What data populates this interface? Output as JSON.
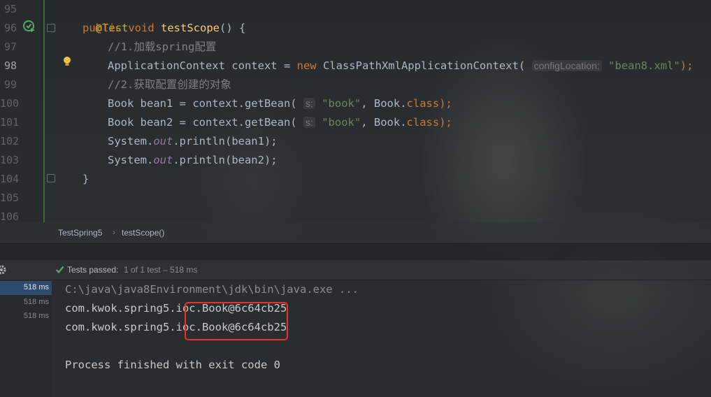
{
  "editor": {
    "line_numbers": [
      "95",
      "96",
      "97",
      "98",
      "99",
      "100",
      "101",
      "102",
      "103",
      "104",
      "105",
      "106"
    ],
    "current_line": "98",
    "lines": {
      "l95": {
        "annotation": "@Test"
      },
      "l96": {
        "kw_public": "public",
        "kw_void": "void",
        "method": "testScope",
        "rest": "() {"
      },
      "l97": {
        "comment": "//1.加载spring配置"
      },
      "l98": {
        "type": "ApplicationContext context = ",
        "kw_new": "new",
        "ctor": " ClassPathXmlApplicationContext(",
        "hint": "configLocation:",
        "string": "\"bean8.xml\"",
        "end": ");"
      },
      "l99": {
        "comment": "//2.获取配置创建的对象"
      },
      "l100": {
        "start": "Book bean1 = context.getBean(",
        "hint": "s:",
        "string": "\"book\"",
        "mid": ", Book.",
        "kw_class": "class",
        "end": ");"
      },
      "l101": {
        "start": "Book bean2 = context.getBean(",
        "hint": "s:",
        "string": "\"book\"",
        "mid": ", Book.",
        "kw_class": "class",
        "end": ");"
      },
      "l102": {
        "start": "System.",
        "field": "out",
        "end": ".println(bean1);"
      },
      "l103": {
        "start": "System.",
        "field": "out",
        "end": ".println(bean2);"
      },
      "l104": {
        "brace": "}"
      }
    }
  },
  "breadcrumb": {
    "class_name": "TestSpring5",
    "separator": "›",
    "method": "testScope()"
  },
  "test_status": {
    "label": "Tests passed:",
    "count": "1 of 1 test – 518 ms"
  },
  "tree": {
    "durations": [
      "518 ms",
      "518 ms",
      "518 ms"
    ]
  },
  "console": {
    "command": "C:\\java\\java8Environment\\jdk\\bin\\java.exe ...",
    "output": [
      "com.kwok.spring5.ioc.Book@6c64cb25",
      "com.kwok.spring5.ioc.Book@6c64cb25"
    ],
    "exit": "Process finished with exit code 0"
  },
  "colors": {
    "keyword": "#cc7832",
    "string": "#6a8759",
    "comment": "#808080",
    "highlight": "#e8312a",
    "pass": "#59a869"
  }
}
